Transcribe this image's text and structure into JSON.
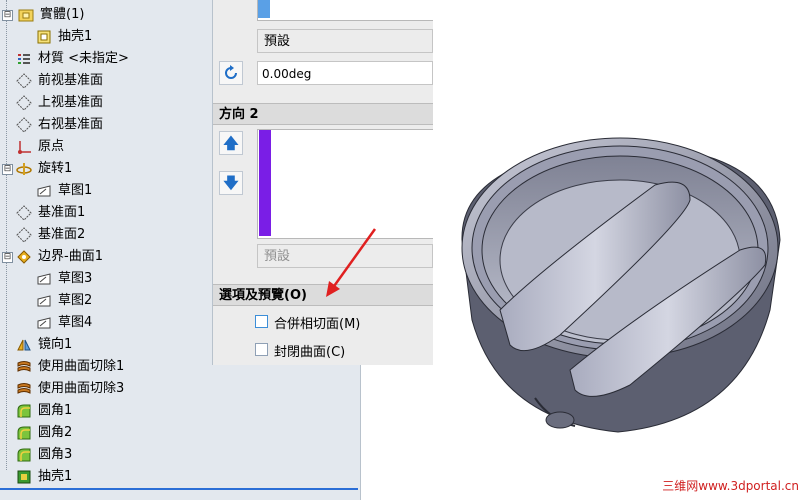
{
  "feature_tree": {
    "items": [
      {
        "label": "實體(1)",
        "icon": "folder-icon",
        "expander": "⊟"
      },
      {
        "label": "抽壳1",
        "icon": "shell-feature-icon",
        "expander": ""
      },
      {
        "label": "材質 <未指定>",
        "icon": "material-icon",
        "expander": ""
      },
      {
        "label": "前视基准面",
        "icon": "plane-icon",
        "expander": ""
      },
      {
        "label": "上视基准面",
        "icon": "plane-icon",
        "expander": ""
      },
      {
        "label": "右视基准面",
        "icon": "plane-icon",
        "expander": ""
      },
      {
        "label": "原点",
        "icon": "origin-icon",
        "expander": ""
      },
      {
        "label": "旋转1",
        "icon": "revolve-icon",
        "expander": "⊟"
      },
      {
        "label": "草图1",
        "icon": "sketch-icon",
        "expander": ""
      },
      {
        "label": "基准面1",
        "icon": "plane-icon",
        "expander": ""
      },
      {
        "label": "基准面2",
        "icon": "plane-icon",
        "expander": ""
      },
      {
        "label": "边界-曲面1",
        "icon": "boundary-surface-icon",
        "expander": "⊟"
      },
      {
        "label": "草图3",
        "icon": "sketch-icon",
        "expander": ""
      },
      {
        "label": "草图2",
        "icon": "sketch-icon",
        "expander": ""
      },
      {
        "label": "草图4",
        "icon": "sketch-icon",
        "expander": ""
      },
      {
        "label": "镜向1",
        "icon": "mirror-icon",
        "expander": ""
      },
      {
        "label": "使用曲面切除1",
        "icon": "surface-cut-icon",
        "expander": ""
      },
      {
        "label": "使用曲面切除3",
        "icon": "surface-cut-icon",
        "expander": ""
      },
      {
        "label": "圆角1",
        "icon": "fillet-icon",
        "expander": ""
      },
      {
        "label": "圆角2",
        "icon": "fillet-icon",
        "expander": ""
      },
      {
        "label": "圆角3",
        "icon": "fillet-icon",
        "expander": ""
      },
      {
        "label": "抽壳1",
        "icon": "shell-feature-icon",
        "expander": ""
      }
    ]
  },
  "property_panel": {
    "direction1_combo": "預設",
    "angle_value": "0.00deg",
    "direction2_title": "方向 2",
    "direction2_combo": "預設",
    "options_title": "選項及預覽(O)",
    "merge_tangent_label": "合併相切面(M)",
    "merge_tangent_checked": false,
    "close_surface_label": "封閉曲面(C)",
    "close_surface_checked": false
  },
  "colors": {
    "direction1_selection": "#5aa0e6",
    "direction2_selection": "#7a1ee6",
    "arrow": "#e02020"
  },
  "watermark": "三维网www.3dportal.cn"
}
